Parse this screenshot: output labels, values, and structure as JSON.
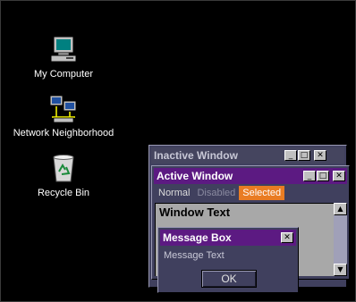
{
  "desktop": {
    "icons": [
      {
        "label": "My Computer",
        "icon": "computer-icon"
      },
      {
        "label": "Network Neighborhood",
        "icon": "network-icon"
      },
      {
        "label": "Recycle Bin",
        "icon": "recycle-bin-icon"
      }
    ],
    "background": "#000000"
  },
  "inactive_window": {
    "title": "Inactive Window",
    "title_bg": "#45455f"
  },
  "active_window": {
    "title": "Active Window",
    "title_bg": "#5c1a82",
    "menu": {
      "normal": "Normal",
      "disabled": "Disabled",
      "selected": "Selected"
    },
    "selected_color": "#e97c23",
    "window_text": "Window Text"
  },
  "message_box": {
    "title": "Message Box",
    "text": "Message Text",
    "ok_label": "OK"
  }
}
